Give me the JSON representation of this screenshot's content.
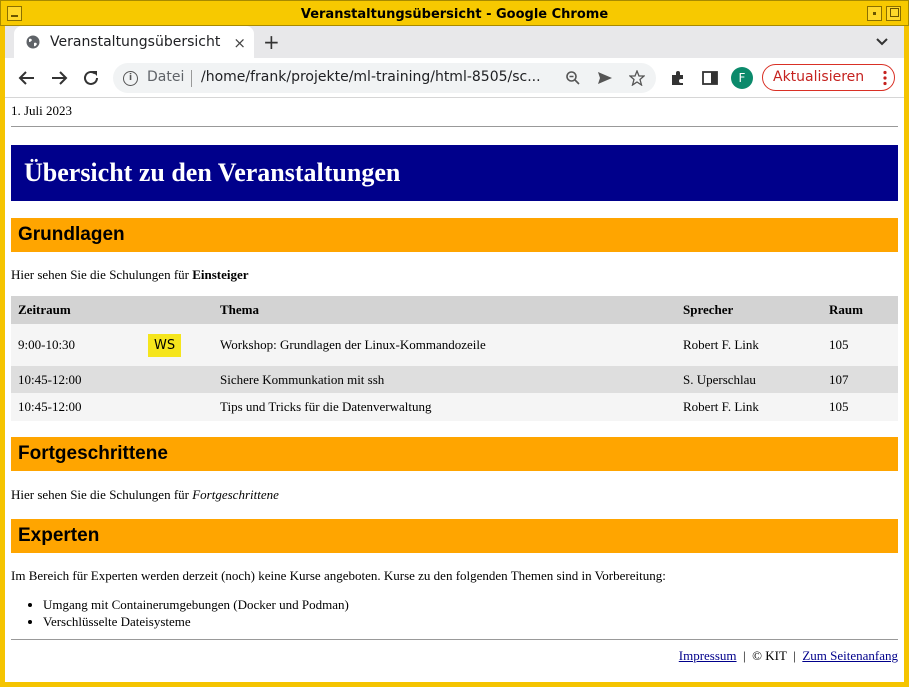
{
  "window": {
    "title": "Veranstaltungsübersicht - Google Chrome"
  },
  "browser": {
    "tab_title": "Veranstaltungsübersicht",
    "tab_close": "×",
    "new_tab": "+",
    "address_prefix": "Datei",
    "address_url": "/home/frank/projekte/ml-training/html-8505/sc...",
    "profile_initial": "F",
    "update_label": "Aktualisieren"
  },
  "page": {
    "date": "1. Juli 2023",
    "main_title": "Übersicht zu den Veranstaltungen",
    "sections": {
      "basics": {
        "title": "Grundlagen",
        "intro_text": "Hier sehen Sie die Schulungen für ",
        "intro_emph": "Einsteiger"
      },
      "advanced": {
        "title": "Fortgeschrittene",
        "intro_text": "Hier sehen Sie die Schulungen für ",
        "intro_emph": "Fortgeschrittene"
      },
      "experts": {
        "title": "Experten",
        "intro_text": "Im Bereich für Experten werden derzeit (noch) keine Kurse angeboten. Kurse zu den folgenden Themen sind in Vorbereitung:",
        "topics": [
          "Umgang mit Containerumgebungen (Docker und Podman)",
          "Verschlüsselte Dateisysteme"
        ]
      }
    },
    "schedule": {
      "headers": [
        "Zeitraum",
        "",
        "Thema",
        "Sprecher",
        "Raum"
      ],
      "rows": [
        {
          "time": "9:00-10:30",
          "badge": "WS",
          "topic": "Workshop: Grundlagen der Linux-Kommandozeile",
          "speaker": "Robert F. Link",
          "room": "105"
        },
        {
          "time": "10:45-12:00",
          "badge": "",
          "topic": "Sichere Kommunkation mit ssh",
          "speaker": "S. Uperschlau",
          "room": "107"
        },
        {
          "time": "10:45-12:00",
          "badge": "",
          "topic": "Tips und Tricks für die Datenverwaltung",
          "speaker": "Robert F. Link",
          "room": "105"
        }
      ]
    },
    "footer": {
      "impressum": "Impressum",
      "separator": "|",
      "copyright": "© KIT",
      "top_link": "Zum Seitenanfang"
    }
  },
  "colors": {
    "banner": "#00008b",
    "section_header": "#ffa500",
    "badge": "#f5e51c",
    "window_frame": "#f5c400"
  }
}
